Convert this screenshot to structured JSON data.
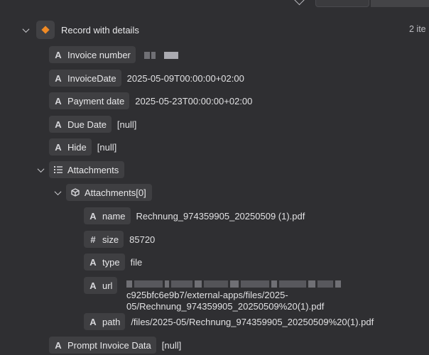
{
  "root": {
    "label": "Record with details",
    "count": "2 ite"
  },
  "fields": [
    {
      "type_icon": "A",
      "label": "Invoice number",
      "value": ""
    },
    {
      "type_icon": "A",
      "label": "InvoiceDate",
      "value": "2025-05-09T00:00:00+02:00"
    },
    {
      "type_icon": "A",
      "label": "Payment date",
      "value": "2025-05-23T00:00:00+02:00"
    },
    {
      "type_icon": "A",
      "label": "Due Date",
      "value": "[null]"
    },
    {
      "type_icon": "A",
      "label": "Hide",
      "value": "[null]"
    }
  ],
  "attachments": {
    "icon": "list-icon",
    "label": "Attachments",
    "item": {
      "icon": "cube-icon",
      "label": "Attachments[0]",
      "fields": [
        {
          "type_icon": "A",
          "label": "name",
          "value": "Rechnung_974359905_20250509 (1).pdf"
        },
        {
          "type_icon": "#",
          "label": "size",
          "value": "85720"
        },
        {
          "type_icon": "A",
          "label": "type",
          "value": "file"
        },
        {
          "type_icon": "A",
          "label": "url",
          "value_line2": "c925bfc6e9b7/external-apps/files/2025-",
          "value_line3": "05/Rechnung_974359905_20250509%20(1).pdf"
        },
        {
          "type_icon": "A",
          "label": "path",
          "value": "/files/2025-05/Rechnung_974359905_20250509%20(1).pdf"
        }
      ]
    }
  },
  "prompt_field": {
    "type_icon": "A",
    "label": "Prompt Invoice Data",
    "value": "[null]"
  },
  "colors": {
    "background": "#2f2f32",
    "chip": "#3f3f42",
    "accent": "#f08a24"
  }
}
